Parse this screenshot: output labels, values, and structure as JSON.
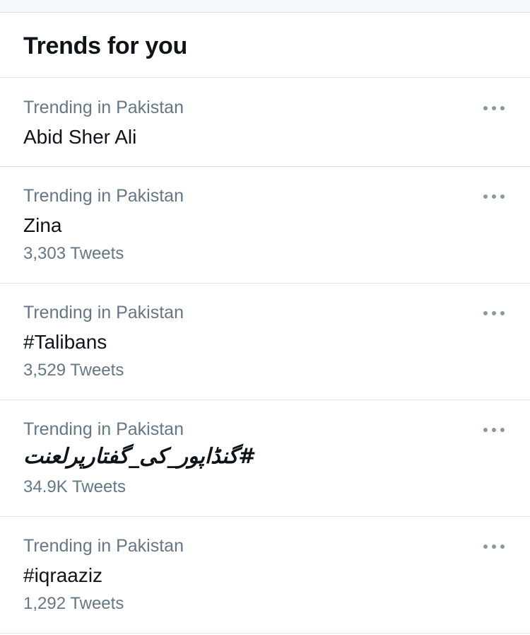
{
  "header": {
    "title": "Trends for you"
  },
  "trends": [
    {
      "context": "Trending in Pakistan",
      "name": "Abid Sher Ali",
      "count": ""
    },
    {
      "context": "Trending in Pakistan",
      "name": "Zina",
      "count": "3,303 Tweets"
    },
    {
      "context": "Trending in Pakistan",
      "name": "#Talibans",
      "count": "3,529 Tweets"
    },
    {
      "context": "Trending in Pakistan",
      "name": "#گنڈاپور_کی_گفتارپرلعنت",
      "count": "34.9K Tweets"
    },
    {
      "context": "Trending in Pakistan",
      "name": "#iqraaziz",
      "count": "1,292 Tweets"
    }
  ],
  "icons": {
    "more": "more-horizontal-icon"
  },
  "colors": {
    "text_primary": "#0f1419",
    "text_secondary": "#657786",
    "divider": "#dfe3e6",
    "icon": "#8899a6"
  }
}
